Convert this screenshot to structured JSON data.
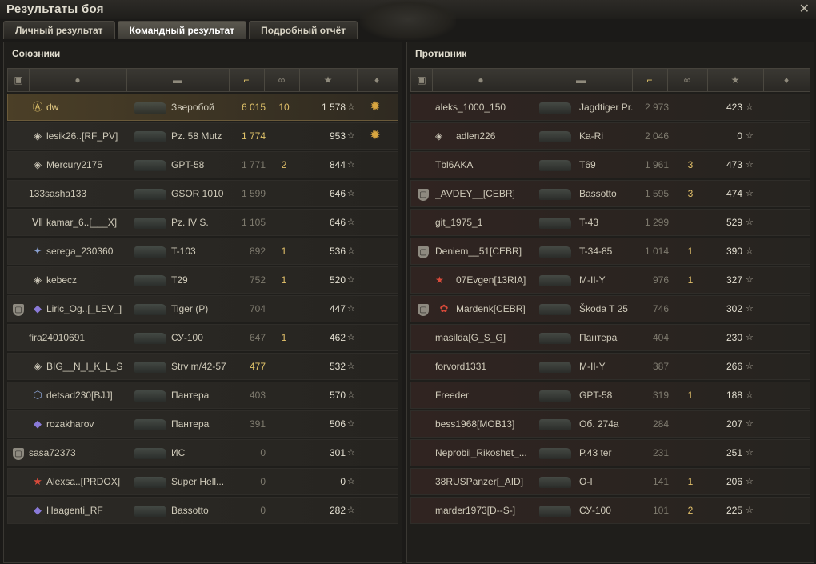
{
  "window": {
    "title": "Результаты боя"
  },
  "tabs": [
    {
      "label": "Личный результат"
    },
    {
      "label": "Командный результат"
    },
    {
      "label": "Подробный отчёт"
    }
  ],
  "allies": {
    "title": "Союзники",
    "rows": [
      {
        "name": "dw",
        "tank": "Зверобой",
        "damage": "6 015",
        "frags": "10",
        "xp": "1 578",
        "medal": "3"
      },
      {
        "name": "lesik26..[RF_PV]",
        "tank": "Pz. 58 Mutz",
        "damage": "1 774",
        "frags": "",
        "xp": "953",
        "medal": ""
      },
      {
        "name": "Mercury2175",
        "tank": "GPT-58",
        "damage": "1 771",
        "frags": "2",
        "xp": "844",
        "medal": ""
      },
      {
        "name": "133sasha133",
        "tank": "GSOR 1010",
        "damage": "1 599",
        "frags": "",
        "xp": "646",
        "medal": ""
      },
      {
        "name": "kamar_6..[___X]",
        "tank": "Pz. IV S.",
        "damage": "1 105",
        "frags": "",
        "xp": "646",
        "medal": ""
      },
      {
        "name": "serega_230360",
        "tank": "T-103",
        "damage": "892",
        "frags": "1",
        "xp": "536",
        "medal": ""
      },
      {
        "name": "kebecz",
        "tank": "T29",
        "damage": "752",
        "frags": "1",
        "xp": "520",
        "medal": ""
      },
      {
        "name": "Liric_Og..[_LEV_]",
        "tank": "Tiger (P)",
        "damage": "704",
        "frags": "",
        "xp": "447",
        "medal": ""
      },
      {
        "name": "fira24010691",
        "tank": "СУ-100",
        "damage": "647",
        "frags": "1",
        "xp": "462",
        "medal": ""
      },
      {
        "name": "BIG__N_I_K_L_S",
        "tank": "Strv m/42-57",
        "damage": "477",
        "frags": "",
        "xp": "532",
        "medal": ""
      },
      {
        "name": "detsad230[BJJ]",
        "tank": "Пантера",
        "damage": "403",
        "frags": "",
        "xp": "570",
        "medal": ""
      },
      {
        "name": "rozakharov",
        "tank": "Пантера",
        "damage": "391",
        "frags": "",
        "xp": "506",
        "medal": ""
      },
      {
        "name": "sasa72373",
        "tank": "ИС",
        "damage": "0",
        "frags": "",
        "xp": "301",
        "medal": ""
      },
      {
        "name": "Alexsa..[PRDOX]",
        "tank": "Super Hell...",
        "damage": "0",
        "frags": "",
        "xp": "0",
        "medal": ""
      },
      {
        "name": "Haagenti_RF",
        "tank": "Bassotto",
        "damage": "0",
        "frags": "",
        "xp": "282",
        "medal": ""
      }
    ]
  },
  "enemies": {
    "title": "Противник",
    "rows": [
      {
        "name": "aleks_1000_150",
        "tank": "Jagdtiger Pr.",
        "damage": "2 973",
        "frags": "",
        "xp": "423"
      },
      {
        "name": "adlen226",
        "tank": "Ka-Ri",
        "damage": "2 046",
        "frags": "",
        "xp": "0"
      },
      {
        "name": "Tbl6AKA",
        "tank": "T69",
        "damage": "1 961",
        "frags": "3",
        "xp": "473"
      },
      {
        "name": "_AVDEY__[CEBR]",
        "tank": "Bassotto",
        "damage": "1 595",
        "frags": "3",
        "xp": "474"
      },
      {
        "name": "git_1975_1",
        "tank": "T-43",
        "damage": "1 299",
        "frags": "",
        "xp": "529"
      },
      {
        "name": "Deniem__51[CEBR]",
        "tank": "T-34-85",
        "damage": "1 014",
        "frags": "1",
        "xp": "390"
      },
      {
        "name": "07Evgen[13RIA]",
        "tank": "M-II-Y",
        "damage": "976",
        "frags": "1",
        "xp": "327"
      },
      {
        "name": "Mardenk[CEBR]",
        "tank": "Škoda T 25",
        "damage": "746",
        "frags": "",
        "xp": "302"
      },
      {
        "name": "masilda[G_S_G]",
        "tank": "Пантера",
        "damage": "404",
        "frags": "",
        "xp": "230"
      },
      {
        "name": "forvord1331",
        "tank": "M-II-Y",
        "damage": "387",
        "frags": "",
        "xp": "266"
      },
      {
        "name": "Freeder",
        "tank": "GPT-58",
        "damage": "319",
        "frags": "1",
        "xp": "188"
      },
      {
        "name": "bess1968[MOB13]",
        "tank": "Об. 274a",
        "damage": "284",
        "frags": "",
        "xp": "207"
      },
      {
        "name": "Neprobil_Rikoshet_...",
        "tank": "P.43 ter",
        "damage": "231",
        "frags": "",
        "xp": "251"
      },
      {
        "name": "38RUSPanzer[_AID]",
        "tank": "O-I",
        "damage": "141",
        "frags": "1",
        "xp": "206"
      },
      {
        "name": "marder1973[D--S-]",
        "tank": "СУ-100",
        "damage": "101",
        "frags": "2",
        "xp": "225"
      }
    ]
  },
  "icons": {
    "close": "close-icon",
    "header": [
      "squad-icon",
      "player-icon",
      "tank-icon",
      "damage-icon",
      "frags-icon",
      "xp-star-icon",
      "medal-icon"
    ]
  },
  "colors": {
    "accent": "#e0c36a",
    "highlight_row": "#4b3f27"
  }
}
